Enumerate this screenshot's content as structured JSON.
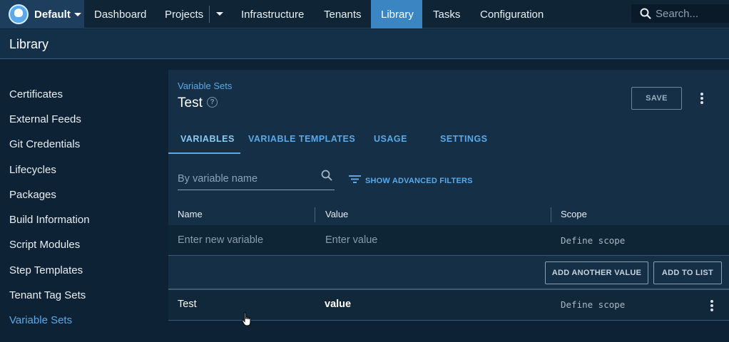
{
  "topnav": {
    "space_name": "Default",
    "items": [
      {
        "label": "Dashboard"
      },
      {
        "label": "Projects"
      },
      {
        "label": "Infrastructure"
      },
      {
        "label": "Tenants"
      },
      {
        "label": "Library"
      },
      {
        "label": "Tasks"
      },
      {
        "label": "Configuration"
      }
    ],
    "active_item": "Library",
    "search_placeholder": "Search..."
  },
  "page": {
    "title": "Library"
  },
  "sidebar": {
    "items": [
      {
        "label": "Certificates"
      },
      {
        "label": "External Feeds"
      },
      {
        "label": "Git Credentials"
      },
      {
        "label": "Lifecycles"
      },
      {
        "label": "Packages"
      },
      {
        "label": "Build Information"
      },
      {
        "label": "Script Modules"
      },
      {
        "label": "Step Templates"
      },
      {
        "label": "Tenant Tag Sets"
      },
      {
        "label": "Variable Sets"
      }
    ],
    "active_item": "Variable Sets"
  },
  "main": {
    "breadcrumb": "Variable Sets",
    "title": "Test",
    "save_label": "SAVE",
    "tabs": [
      {
        "label": "VARIABLES"
      },
      {
        "label": "VARIABLE TEMPLATES"
      },
      {
        "label": "USAGE"
      },
      {
        "label": "SETTINGS"
      }
    ],
    "active_tab": "VARIABLES",
    "filter_placeholder": "By variable name",
    "advanced_filters_label": "SHOW ADVANCED FILTERS",
    "columns": [
      "Name",
      "Value",
      "Scope"
    ],
    "new_row": {
      "name_placeholder": "Enter new variable",
      "value_placeholder": "Enter value",
      "scope_placeholder": "Define scope"
    },
    "add_another_value_label": "ADD ANOTHER VALUE",
    "add_to_list_label": "ADD TO LIST",
    "rows": [
      {
        "name": "Test",
        "value": "value",
        "scope": "Define scope"
      }
    ]
  },
  "colors": {
    "accent": "#5aa9e8",
    "active_nav": "#3b86c2",
    "background": "#0e2235",
    "card": "#142f46"
  }
}
